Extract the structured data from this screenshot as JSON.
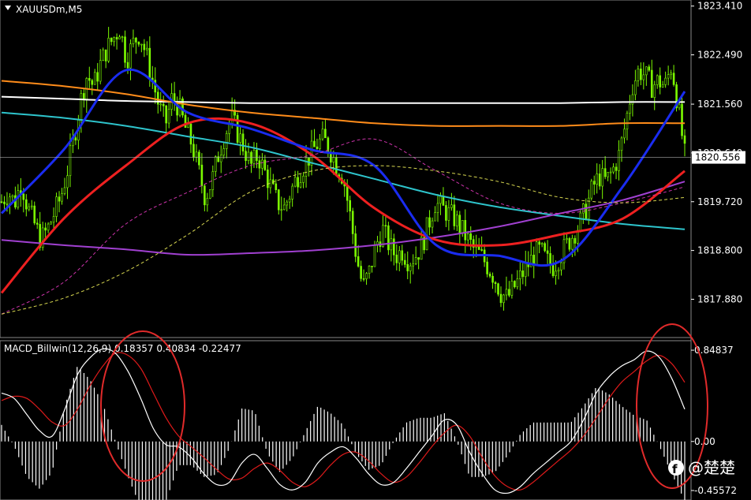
{
  "chart_data": [
    {
      "type": "line",
      "title": "XAUUSDm,M5",
      "symbol_icon": "triangle-down-icon",
      "current_price": "1820.556",
      "y_ticks": [
        "1823.410",
        "1822.490",
        "1821.560",
        "1820.640",
        "1819.720",
        "1818.800",
        "1817.880"
      ],
      "ylim": [
        1817.5,
        1823.45
      ],
      "grid": false,
      "candle_color": "#7CFC00",
      "candle_count": 250,
      "closes": [
        1819.72,
        1819.9,
        1819.7,
        1820.1,
        1819.6,
        1819.3,
        1819.0,
        1819.2,
        1819.5,
        1819.8,
        1820.3,
        1820.9,
        1821.6,
        1822.1,
        1821.9,
        1822.3,
        1822.6,
        1822.8,
        1823.0,
        1822.4,
        1822.7,
        1822.9,
        1822.5,
        1822.0,
        1821.5,
        1821.2,
        1821.7,
        1821.5,
        1821.1,
        1820.8,
        1820.3,
        1819.8,
        1820.1,
        1820.6,
        1821.0,
        1821.3,
        1821.0,
        1820.7,
        1820.4,
        1820.6,
        1820.3,
        1820.0,
        1819.7,
        1819.6,
        1819.9,
        1820.2,
        1820.4,
        1820.6,
        1820.8,
        1820.9,
        1820.7,
        1820.4,
        1820.2,
        1819.5,
        1818.7,
        1818.1,
        1818.4,
        1818.9,
        1819.2,
        1818.9,
        1818.7,
        1818.8,
        1818.6,
        1818.7,
        1818.9,
        1819.3,
        1819.7,
        1819.6,
        1819.5,
        1819.4,
        1819.2,
        1819.0,
        1818.8,
        1818.7,
        1818.5,
        1818.3,
        1818.0,
        1817.9,
        1818.1,
        1818.3,
        1818.5,
        1818.7,
        1818.8,
        1818.6,
        1818.5,
        1818.7,
        1818.9,
        1819.1,
        1819.3,
        1819.6,
        1820.0,
        1820.2,
        1820.1,
        1820.3,
        1820.6,
        1821.2,
        1821.9,
        1822.2,
        1822.1,
        1821.9,
        1822.0,
        1821.9,
        1822.3,
        1821.5,
        1820.6
      ],
      "moving_averages": [
        {
          "color": "#ffffff",
          "values": [
            1821.7,
            1821.66,
            1821.62,
            1821.6,
            1821.58,
            1821.58,
            1821.58,
            1821.58,
            1821.58,
            1821.58,
            1821.6,
            1821.6
          ]
        },
        {
          "color": "#ff8c1a",
          "values": [
            1822.0,
            1821.9,
            1821.75,
            1821.55,
            1821.4,
            1821.3,
            1821.2,
            1821.15,
            1821.15,
            1821.15,
            1821.2,
            1821.2
          ]
        },
        {
          "color": "#2ec4cc",
          "values": [
            1821.4,
            1821.3,
            1821.15,
            1820.95,
            1820.75,
            1820.45,
            1820.15,
            1819.85,
            1819.62,
            1819.45,
            1819.3,
            1819.2
          ]
        },
        {
          "color": "#a040d0",
          "values": [
            1819.0,
            1818.9,
            1818.82,
            1818.72,
            1818.75,
            1818.8,
            1818.9,
            1819.05,
            1819.25,
            1819.5,
            1819.75,
            1820.1
          ]
        },
        {
          "color": "#ee2020",
          "values": [
            1818.0,
            1819.4,
            1820.4,
            1821.2,
            1821.2,
            1820.6,
            1819.6,
            1819.0,
            1818.9,
            1819.1,
            1819.4,
            1820.3
          ]
        },
        {
          "color": "#1a2cf0",
          "values": [
            1819.5,
            1820.7,
            1822.2,
            1821.4,
            1821.1,
            1820.7,
            1820.4,
            1818.9,
            1818.7,
            1818.6,
            1820.0,
            1821.8
          ]
        },
        {
          "color": "#cc33aa",
          "values": [
            1817.6,
            1818.2,
            1819.3,
            1819.9,
            1820.4,
            1820.6,
            1820.9,
            1820.3,
            1819.7,
            1819.5,
            1819.7,
            1820.0
          ]
        },
        {
          "color": "#d8d850",
          "values": [
            1817.6,
            1817.9,
            1818.4,
            1819.1,
            1819.9,
            1820.3,
            1820.4,
            1820.3,
            1820.1,
            1819.8,
            1819.7,
            1819.8
          ]
        }
      ]
    },
    {
      "type": "line",
      "title": "MACD_Billwin(12,26,9) 0.18357 0.40834 -0.22477",
      "y_ticks": [
        "0.84837",
        "0.00",
        "-0.45572"
      ],
      "ylim": [
        -0.5,
        0.9
      ],
      "series": [
        {
          "color": "#ffffff",
          "values": [
            0.45,
            0.4,
            0.25,
            0.1,
            0.05,
            0.3,
            0.62,
            0.78,
            0.86,
            0.82,
            0.65,
            0.4,
            0.12,
            -0.03,
            -0.05,
            -0.15,
            -0.3,
            -0.4,
            -0.38,
            -0.2,
            -0.12,
            -0.25,
            -0.4,
            -0.45,
            -0.38,
            -0.2,
            -0.1,
            -0.05,
            -0.15,
            -0.3,
            -0.4,
            -0.38,
            -0.25,
            -0.1,
            0.05,
            0.2,
            0.15,
            -0.1,
            -0.3,
            -0.45,
            -0.48,
            -0.42,
            -0.3,
            -0.2,
            -0.1,
            0.0,
            0.2,
            0.45,
            0.6,
            0.7,
            0.76,
            0.84,
            0.78,
            0.58,
            0.3
          ]
        },
        {
          "color": "#dd1a1a",
          "values": [
            0.38,
            0.42,
            0.4,
            0.3,
            0.18,
            0.15,
            0.3,
            0.52,
            0.7,
            0.82,
            0.8,
            0.68,
            0.45,
            0.22,
            0.05,
            -0.05,
            -0.15,
            -0.26,
            -0.35,
            -0.34,
            -0.25,
            -0.2,
            -0.27,
            -0.38,
            -0.42,
            -0.35,
            -0.22,
            -0.12,
            -0.1,
            -0.18,
            -0.3,
            -0.38,
            -0.33,
            -0.2,
            -0.05,
            0.08,
            0.15,
            0.05,
            -0.15,
            -0.32,
            -0.42,
            -0.45,
            -0.38,
            -0.28,
            -0.18,
            -0.08,
            0.05,
            0.22,
            0.4,
            0.55,
            0.65,
            0.75,
            0.8,
            0.72,
            0.55
          ]
        }
      ],
      "histogram_color": "#ffffff"
    }
  ],
  "annotations": [
    {
      "type": "ellipse",
      "color": "#e02a2a",
      "label": ""
    },
    {
      "type": "ellipse",
      "color": "#e02a2a",
      "label": ""
    }
  ],
  "watermark": {
    "icon": "facebook-icon",
    "text": "@楚楚"
  }
}
